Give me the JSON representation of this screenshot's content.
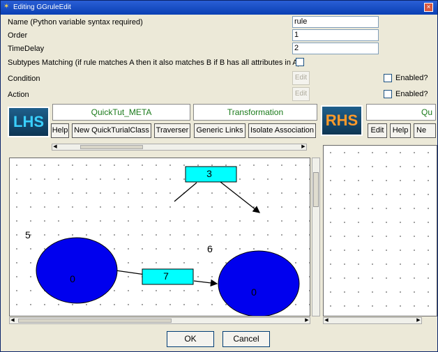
{
  "window": {
    "title": "Editing GGruleEdit",
    "close_glyph": "×"
  },
  "fields": {
    "name": {
      "label": "Name (Python variable syntax required)",
      "value": "rule"
    },
    "order": {
      "label": "Order",
      "value": "1"
    },
    "time_delay": {
      "label": "TimeDelay",
      "value": "2"
    },
    "subtypes": {
      "label": "Subtypes Matching (if rule matches A then it also matches B if B has all attributes in A)",
      "checked": false
    },
    "condition": {
      "label": "Condition",
      "edit_label": "Edit",
      "enabled_label": "Enabled?",
      "enabled": false
    },
    "action": {
      "label": "Action",
      "edit_label": "Edit",
      "enabled_label": "Enabled?",
      "enabled": false
    }
  },
  "lhs": {
    "logo": "LHS",
    "headers": [
      "QuickTut_META",
      "Transformation"
    ],
    "buttons": [
      "Help",
      "New QuickTurialClass",
      "Traverser",
      "Generic Links",
      "Isolate Association"
    ]
  },
  "rhs": {
    "logo": "RHS",
    "header_partial": "Qu",
    "buttons": [
      "Edit",
      "Help",
      "Ne"
    ]
  },
  "graph": {
    "labels": {
      "top_box": "3",
      "mid_box": "7",
      "label_5": "5",
      "label_6": "6",
      "node_left": "0",
      "node_right": "0"
    },
    "colors": {
      "node": "#0000ee",
      "box": "#00ffff"
    }
  },
  "dialog": {
    "ok": "OK",
    "cancel": "Cancel"
  }
}
